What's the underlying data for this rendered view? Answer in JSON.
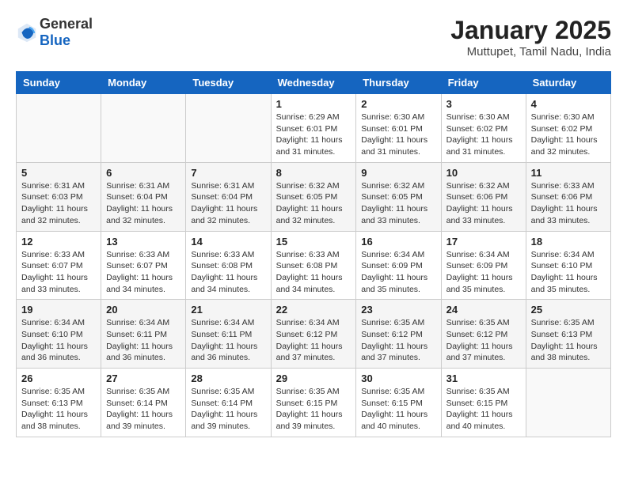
{
  "header": {
    "logo_general": "General",
    "logo_blue": "Blue",
    "month_year": "January 2025",
    "location": "Muttupet, Tamil Nadu, India"
  },
  "weekdays": [
    "Sunday",
    "Monday",
    "Tuesday",
    "Wednesday",
    "Thursday",
    "Friday",
    "Saturday"
  ],
  "weeks": [
    [
      {
        "day": "",
        "sunrise": "",
        "sunset": "",
        "daylight": ""
      },
      {
        "day": "",
        "sunrise": "",
        "sunset": "",
        "daylight": ""
      },
      {
        "day": "",
        "sunrise": "",
        "sunset": "",
        "daylight": ""
      },
      {
        "day": "1",
        "sunrise": "Sunrise: 6:29 AM",
        "sunset": "Sunset: 6:01 PM",
        "daylight": "Daylight: 11 hours and 31 minutes."
      },
      {
        "day": "2",
        "sunrise": "Sunrise: 6:30 AM",
        "sunset": "Sunset: 6:01 PM",
        "daylight": "Daylight: 11 hours and 31 minutes."
      },
      {
        "day": "3",
        "sunrise": "Sunrise: 6:30 AM",
        "sunset": "Sunset: 6:02 PM",
        "daylight": "Daylight: 11 hours and 31 minutes."
      },
      {
        "day": "4",
        "sunrise": "Sunrise: 6:30 AM",
        "sunset": "Sunset: 6:02 PM",
        "daylight": "Daylight: 11 hours and 32 minutes."
      }
    ],
    [
      {
        "day": "5",
        "sunrise": "Sunrise: 6:31 AM",
        "sunset": "Sunset: 6:03 PM",
        "daylight": "Daylight: 11 hours and 32 minutes."
      },
      {
        "day": "6",
        "sunrise": "Sunrise: 6:31 AM",
        "sunset": "Sunset: 6:04 PM",
        "daylight": "Daylight: 11 hours and 32 minutes."
      },
      {
        "day": "7",
        "sunrise": "Sunrise: 6:31 AM",
        "sunset": "Sunset: 6:04 PM",
        "daylight": "Daylight: 11 hours and 32 minutes."
      },
      {
        "day": "8",
        "sunrise": "Sunrise: 6:32 AM",
        "sunset": "Sunset: 6:05 PM",
        "daylight": "Daylight: 11 hours and 32 minutes."
      },
      {
        "day": "9",
        "sunrise": "Sunrise: 6:32 AM",
        "sunset": "Sunset: 6:05 PM",
        "daylight": "Daylight: 11 hours and 33 minutes."
      },
      {
        "day": "10",
        "sunrise": "Sunrise: 6:32 AM",
        "sunset": "Sunset: 6:06 PM",
        "daylight": "Daylight: 11 hours and 33 minutes."
      },
      {
        "day": "11",
        "sunrise": "Sunrise: 6:33 AM",
        "sunset": "Sunset: 6:06 PM",
        "daylight": "Daylight: 11 hours and 33 minutes."
      }
    ],
    [
      {
        "day": "12",
        "sunrise": "Sunrise: 6:33 AM",
        "sunset": "Sunset: 6:07 PM",
        "daylight": "Daylight: 11 hours and 33 minutes."
      },
      {
        "day": "13",
        "sunrise": "Sunrise: 6:33 AM",
        "sunset": "Sunset: 6:07 PM",
        "daylight": "Daylight: 11 hours and 34 minutes."
      },
      {
        "day": "14",
        "sunrise": "Sunrise: 6:33 AM",
        "sunset": "Sunset: 6:08 PM",
        "daylight": "Daylight: 11 hours and 34 minutes."
      },
      {
        "day": "15",
        "sunrise": "Sunrise: 6:33 AM",
        "sunset": "Sunset: 6:08 PM",
        "daylight": "Daylight: 11 hours and 34 minutes."
      },
      {
        "day": "16",
        "sunrise": "Sunrise: 6:34 AM",
        "sunset": "Sunset: 6:09 PM",
        "daylight": "Daylight: 11 hours and 35 minutes."
      },
      {
        "day": "17",
        "sunrise": "Sunrise: 6:34 AM",
        "sunset": "Sunset: 6:09 PM",
        "daylight": "Daylight: 11 hours and 35 minutes."
      },
      {
        "day": "18",
        "sunrise": "Sunrise: 6:34 AM",
        "sunset": "Sunset: 6:10 PM",
        "daylight": "Daylight: 11 hours and 35 minutes."
      }
    ],
    [
      {
        "day": "19",
        "sunrise": "Sunrise: 6:34 AM",
        "sunset": "Sunset: 6:10 PM",
        "daylight": "Daylight: 11 hours and 36 minutes."
      },
      {
        "day": "20",
        "sunrise": "Sunrise: 6:34 AM",
        "sunset": "Sunset: 6:11 PM",
        "daylight": "Daylight: 11 hours and 36 minutes."
      },
      {
        "day": "21",
        "sunrise": "Sunrise: 6:34 AM",
        "sunset": "Sunset: 6:11 PM",
        "daylight": "Daylight: 11 hours and 36 minutes."
      },
      {
        "day": "22",
        "sunrise": "Sunrise: 6:34 AM",
        "sunset": "Sunset: 6:12 PM",
        "daylight": "Daylight: 11 hours and 37 minutes."
      },
      {
        "day": "23",
        "sunrise": "Sunrise: 6:35 AM",
        "sunset": "Sunset: 6:12 PM",
        "daylight": "Daylight: 11 hours and 37 minutes."
      },
      {
        "day": "24",
        "sunrise": "Sunrise: 6:35 AM",
        "sunset": "Sunset: 6:12 PM",
        "daylight": "Daylight: 11 hours and 37 minutes."
      },
      {
        "day": "25",
        "sunrise": "Sunrise: 6:35 AM",
        "sunset": "Sunset: 6:13 PM",
        "daylight": "Daylight: 11 hours and 38 minutes."
      }
    ],
    [
      {
        "day": "26",
        "sunrise": "Sunrise: 6:35 AM",
        "sunset": "Sunset: 6:13 PM",
        "daylight": "Daylight: 11 hours and 38 minutes."
      },
      {
        "day": "27",
        "sunrise": "Sunrise: 6:35 AM",
        "sunset": "Sunset: 6:14 PM",
        "daylight": "Daylight: 11 hours and 39 minutes."
      },
      {
        "day": "28",
        "sunrise": "Sunrise: 6:35 AM",
        "sunset": "Sunset: 6:14 PM",
        "daylight": "Daylight: 11 hours and 39 minutes."
      },
      {
        "day": "29",
        "sunrise": "Sunrise: 6:35 AM",
        "sunset": "Sunset: 6:15 PM",
        "daylight": "Daylight: 11 hours and 39 minutes."
      },
      {
        "day": "30",
        "sunrise": "Sunrise: 6:35 AM",
        "sunset": "Sunset: 6:15 PM",
        "daylight": "Daylight: 11 hours and 40 minutes."
      },
      {
        "day": "31",
        "sunrise": "Sunrise: 6:35 AM",
        "sunset": "Sunset: 6:15 PM",
        "daylight": "Daylight: 11 hours and 40 minutes."
      },
      {
        "day": "",
        "sunrise": "",
        "sunset": "",
        "daylight": ""
      }
    ]
  ]
}
